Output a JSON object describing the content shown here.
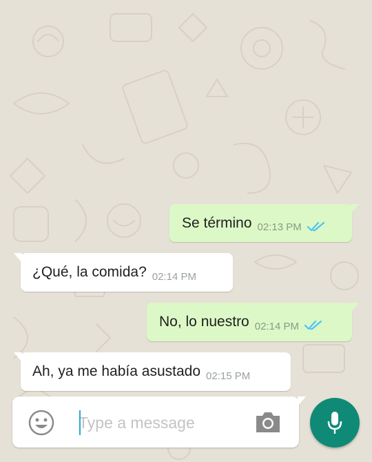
{
  "chat": {
    "messages": [
      {
        "direction": "outgoing",
        "text": "Se término",
        "time": "02:13 PM",
        "status": "read"
      },
      {
        "direction": "incoming",
        "text": "¿Qué, la comida?",
        "time": "02:14 PM"
      },
      {
        "direction": "outgoing",
        "text": "No, lo nuestro",
        "time": "02:14 PM",
        "status": "read"
      },
      {
        "direction": "incoming",
        "text": "Ah, ya me había asustado",
        "time": "02:15 PM"
      }
    ]
  },
  "composer": {
    "placeholder": "Type a message",
    "value": "",
    "emoji_icon": "emoji-icon",
    "camera_icon": "camera-icon",
    "mic_icon": "microphone-icon"
  },
  "colors": {
    "wallpaper": "#e6e1d6",
    "outgoing_bubble": "#dcf8c6",
    "incoming_bubble": "#ffffff",
    "read_ticks": "#4fc3f7",
    "mic_button": "#0f8a76"
  }
}
